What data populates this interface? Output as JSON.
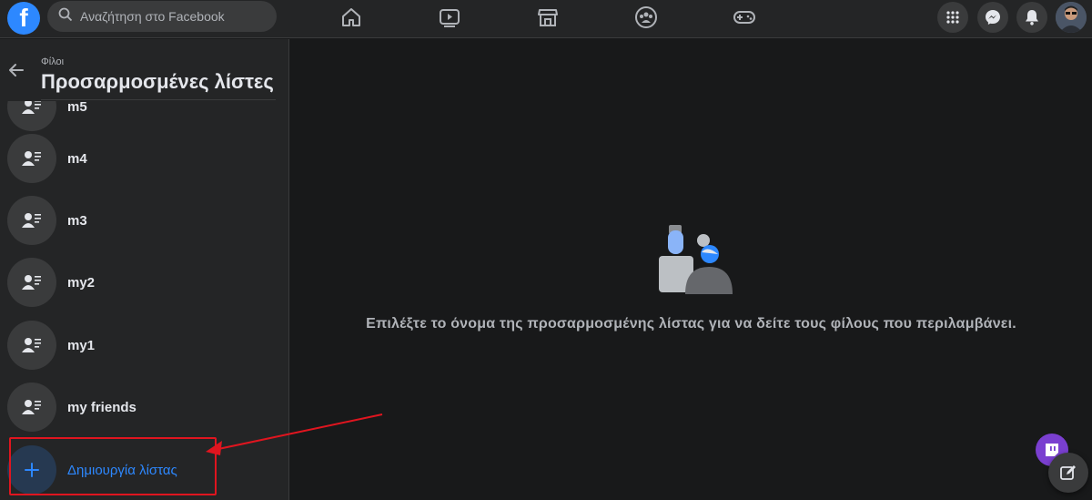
{
  "topbar": {
    "logo_letter": "f",
    "search": {
      "placeholder": "Αναζήτηση στο Facebook"
    },
    "nav": [
      "home-icon",
      "watch-icon",
      "marketplace-icon",
      "groups-icon",
      "gaming-icon"
    ],
    "actions": [
      "menu-grid-icon",
      "messenger-icon",
      "notifications-icon"
    ]
  },
  "sidebar": {
    "breadcrumb": "Φίλοι",
    "title": "Προσαρμοσμένες λίστες",
    "items": [
      {
        "label": "m5"
      },
      {
        "label": "m4"
      },
      {
        "label": "m3"
      },
      {
        "label": "my2"
      },
      {
        "label": "my1"
      },
      {
        "label": "my friends"
      }
    ],
    "create_label": "Δημιουργία λίστας"
  },
  "main": {
    "empty_message": "Επιλέξτε το όνομα της προσαρμοσμένης λίστας για να δείτε τους φίλους που περιλαμβάνει."
  },
  "colors": {
    "accent": "#2d88ff",
    "annotation": "#e0151f",
    "background": "#18191a",
    "surface": "#242526"
  }
}
